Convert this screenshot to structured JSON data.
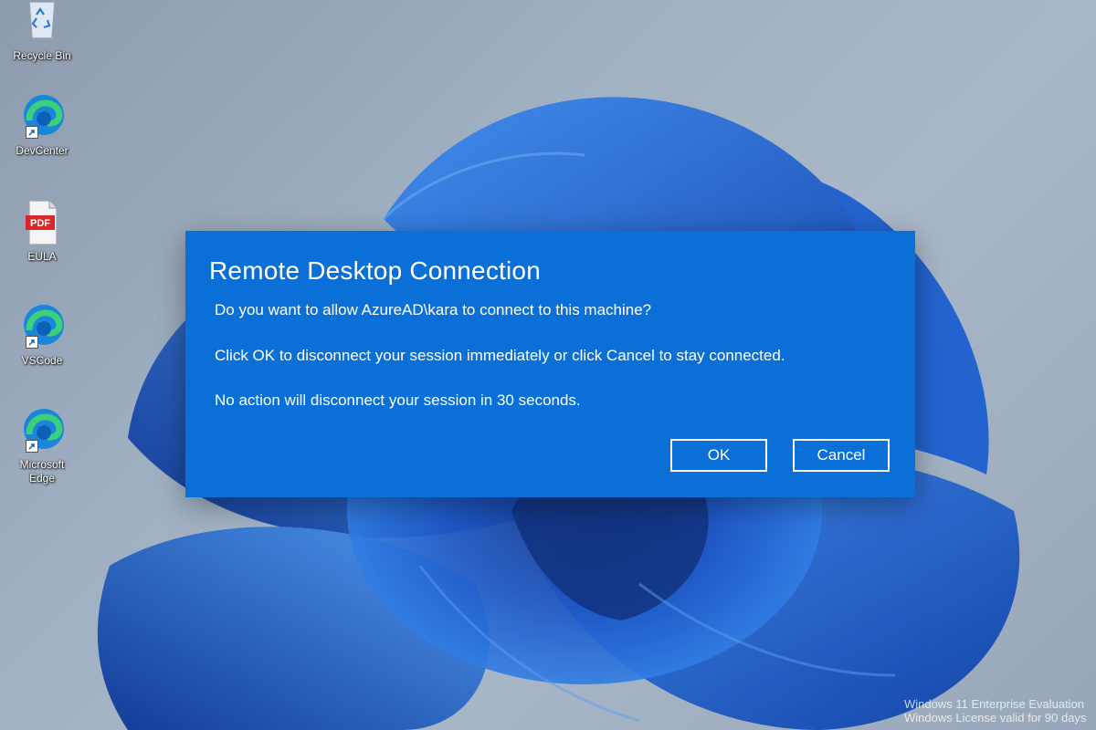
{
  "desktop": {
    "icons": [
      {
        "label": "Recycle Bin",
        "icon": "recycle-bin-icon"
      },
      {
        "label": "DevCenter",
        "icon": "edge-icon"
      },
      {
        "label": "EULA",
        "icon": "pdf-icon",
        "badge": "PDF"
      },
      {
        "label": "VSCode",
        "icon": "edge-icon"
      },
      {
        "label": "Microsoft Edge",
        "icon": "edge-icon"
      }
    ],
    "watermark": {
      "line1": "Windows 11 Enterprise Evaluation",
      "line2": "Windows License valid for 90 days"
    }
  },
  "dialog": {
    "title": "Remote Desktop Connection",
    "message1": "Do you want to allow AzureAD\\kara to connect to this machine?",
    "message2": "Click OK to disconnect your session immediately or click Cancel to stay connected.",
    "message3": "No action will disconnect your session in 30 seconds.",
    "ok_label": "OK",
    "cancel_label": "Cancel"
  },
  "colors": {
    "dialog_bg": "#0b6fd8",
    "wallpaper_bloom": "#1a5fd0"
  }
}
